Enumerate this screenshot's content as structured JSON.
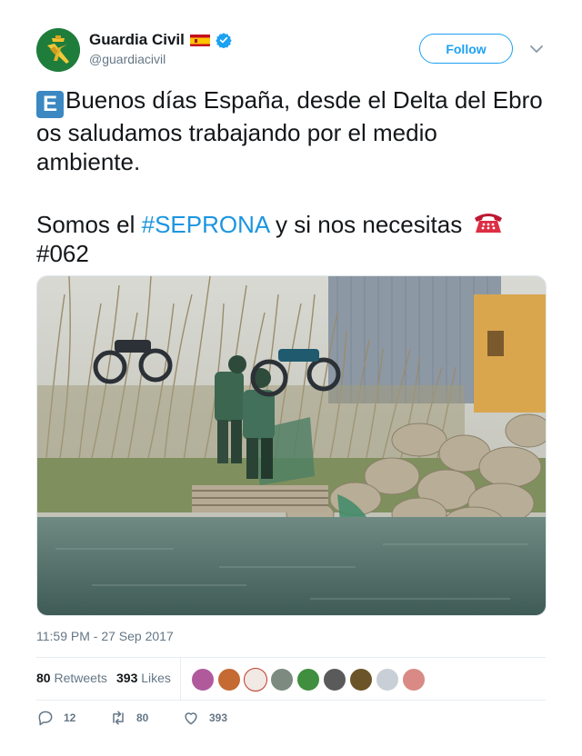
{
  "user": {
    "display_name": "Guardia Civil",
    "handle": "@guardiacivil",
    "verified": true,
    "follow_label": "Follow"
  },
  "tweet": {
    "line1_text": "Buenos días España, desde el Delta del Ebro os saludamos trabajando por el medio ambiente.",
    "line2_pre": "Somos el ",
    "hashtag1": "#SEPRONA",
    "line2_post": " y si nos necesitas",
    "hashtag2": "#062",
    "badge_letter": "E",
    "timestamp": "11:59 PM - 27 Sep 2017"
  },
  "stats": {
    "retweets_count": "80",
    "retweets_label": "Retweets",
    "likes_count": "393",
    "likes_label": "Likes"
  },
  "actions": {
    "reply_count": "12",
    "retweet_count": "80",
    "like_count": "393"
  },
  "colors": {
    "accent": "#1da1f2",
    "hashtag": "#1b95e0",
    "muted": "#657786"
  },
  "icons": [
    "guardia-civil-logo",
    "spain-flag-icon",
    "verified-badge-icon",
    "chevron-down-icon",
    "e-letter-icon",
    "telephone-icon",
    "reply-icon",
    "retweet-icon",
    "like-icon"
  ]
}
